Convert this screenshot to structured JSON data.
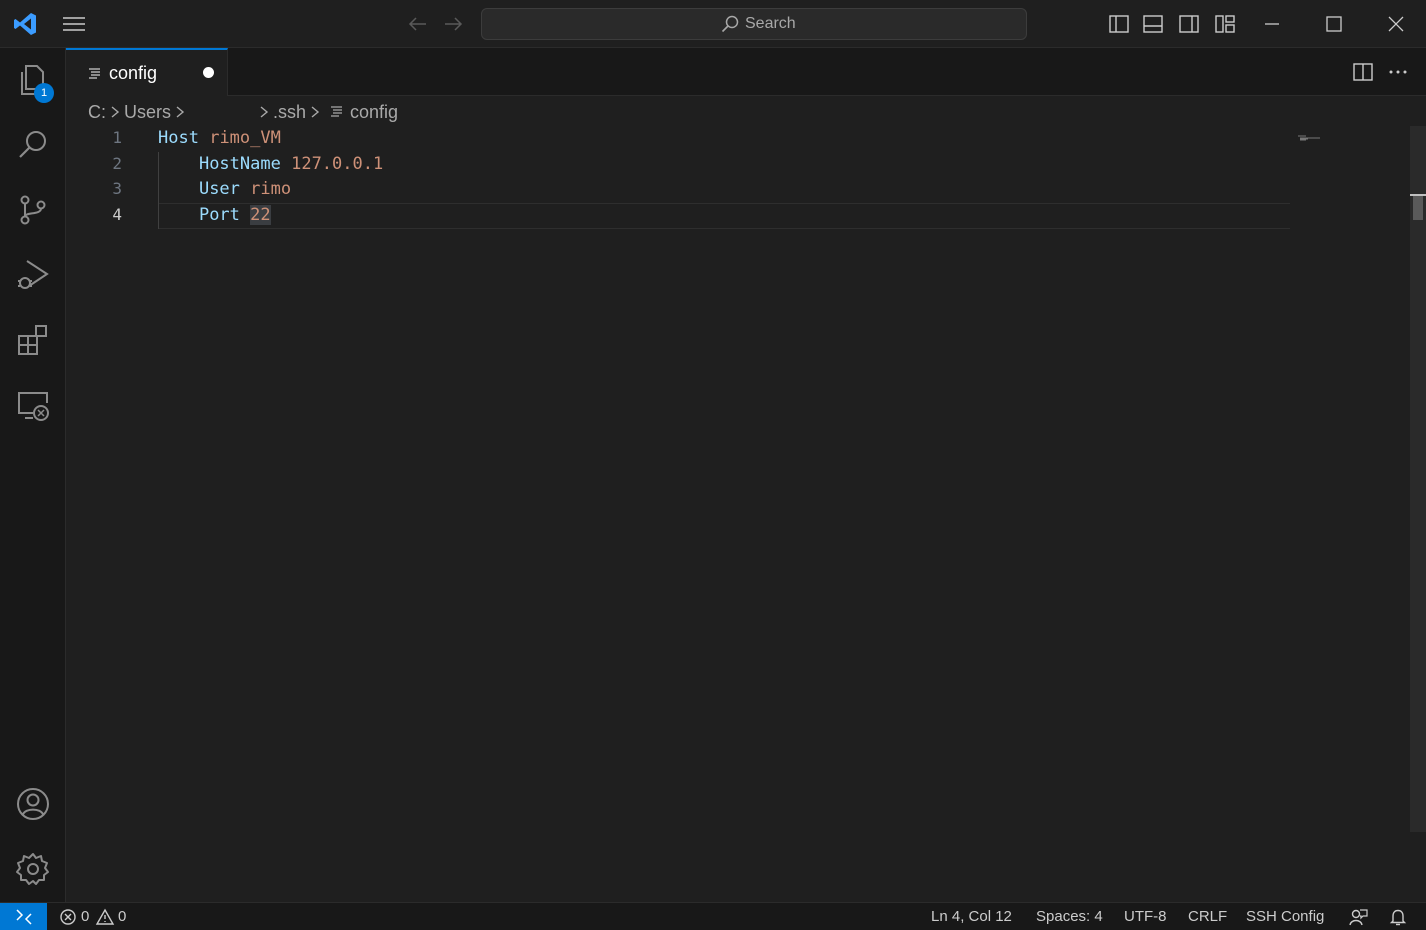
{
  "search": {
    "label": "Search"
  },
  "activity": {
    "explorer_badge": "1"
  },
  "tab": {
    "label": "config"
  },
  "breadcrumb": {
    "items": [
      "C:",
      "Users",
      ".ssh",
      "config"
    ]
  },
  "editor": {
    "lines": [
      {
        "number": "1",
        "keyword": "Host",
        "value": "rimo_VM"
      },
      {
        "number": "2",
        "keyword": "HostName",
        "value": "127.0.0.1"
      },
      {
        "number": "3",
        "keyword": "User",
        "value": "rimo"
      },
      {
        "number": "4",
        "keyword": "Port",
        "value": "22"
      }
    ]
  },
  "status": {
    "errors": "0",
    "warnings": "0",
    "position": "Ln 4, Col 12",
    "spaces": "Spaces: 4",
    "encoding": "UTF-8",
    "eol": "CRLF",
    "language": "SSH Config"
  },
  "colors": {
    "accent": "#0078d4",
    "keyword": "#9cdcfe",
    "string": "#ce9178",
    "background": "#1f1f1f"
  }
}
